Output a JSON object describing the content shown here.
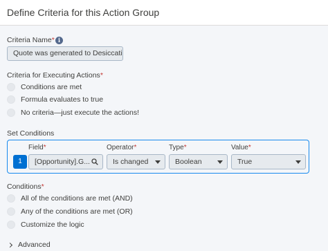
{
  "header": {
    "title": "Define Criteria for this Action Group"
  },
  "criteria_name": {
    "label": "Criteria Name",
    "required_mark": "*",
    "info_icon": "info-icon",
    "value": "Quote was generated to Desiccatio"
  },
  "executing": {
    "label": "Criteria for Executing Actions",
    "required_mark": "*",
    "options": [
      "Conditions are met",
      "Formula evaluates to true",
      "No criteria—just execute the actions!"
    ]
  },
  "set_conditions": {
    "label": "Set Conditions",
    "row": {
      "number": "1",
      "field_label": "Field",
      "field_value": "[Opportunity].G...",
      "operator_label": "Operator",
      "operator_value": "Is changed",
      "type_label": "Type",
      "type_value": "Boolean",
      "value_label": "Value",
      "value_value": "True",
      "required_mark": "*"
    }
  },
  "conditions": {
    "label": "Conditions",
    "required_mark": "*",
    "options": [
      "All of the conditions are met (AND)",
      "Any of the conditions are met (OR)",
      "Customize the logic"
    ]
  },
  "advanced": {
    "label": "Advanced",
    "icon": "chevron-right-icon"
  }
}
